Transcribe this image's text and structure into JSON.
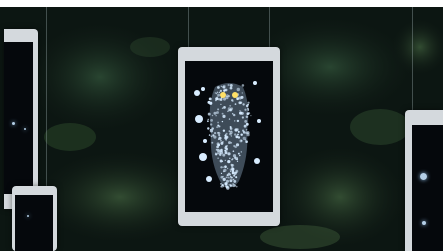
{
  "scene": {
    "subject": "hanging-tablets-owl-display",
    "screen_colors": {
      "screen": "#05080c",
      "particles": "#cfe6ff",
      "eyes": "#ffe066",
      "bezel": "#d4d9dd",
      "foliage": "#1f3a2a"
    }
  },
  "tablets": [
    {
      "id": "center",
      "content": "owl-particle-art"
    },
    {
      "id": "left-top",
      "content": "dark-screen"
    },
    {
      "id": "left-bottom",
      "content": "dark-screen"
    },
    {
      "id": "right",
      "content": "dark-screen"
    }
  ]
}
